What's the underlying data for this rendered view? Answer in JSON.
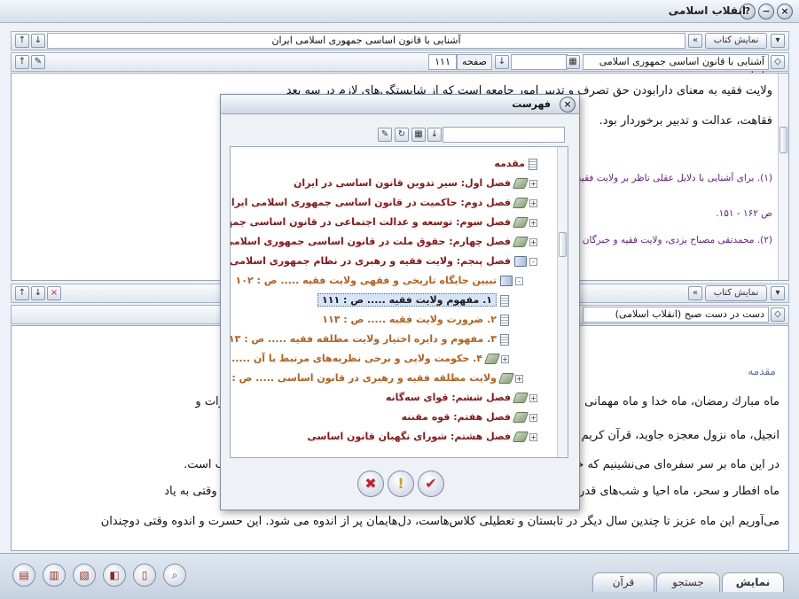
{
  "window": {
    "title": "انقلاب اسلامی"
  },
  "top_pane": {
    "view_book_label": "نمایش کتاب",
    "book_title": "آشنایی با قانون اساسی جمهوری اسلامی ایران",
    "book_select": "آشنایی با قانون اساسی جمهوری اسلامی ایران",
    "page_label": "صفحه",
    "page_value": "۱۱۱",
    "text_lines": [
      "ولایت فقیه به معنای دارابودن حق تصرف و تدبیر امور جامعه است که از شایستگی‌های لازم در سه بعد",
      "فقاهت، عدالت و تدبیر برخوردار بود."
    ],
    "footnotes": [
      "(۱). برای آشنایی با دلایل عقلی ناظر بر ولایت فقیه، رجوع شود به: جوادی آملی، ولایت فقیه؛ ولایت، فقاهت و عدالت،",
      "ص ۱۶۲ - ۱۵۱.",
      "(۲). محمدتقی مصباح یزدی، ولایت فقیه و خبرگان"
    ]
  },
  "bottom_pane": {
    "view_book_label": "نمایش کتاب",
    "book_select": "دست در دست صبح (انقلاب اسلامی)",
    "heading": "مقدمه",
    "text_lines": [
      "ماه مبارك رمضان، ماه خدا و ماه مهمانی خداست؛ ماه بهار قرآن و ماه دوستی و مهربانی دوست، ماه نزول زبور و تورات و",
      "انجیل، ماه نزول معجزه جاوید، قرآن کریم است؛ ماهی که نفس‌های روزه‌داران در آن تسبیح است.",
      "در این ماه بر سر سفره‌ای می‌نشینیم که خداوند گسترده است؛ خواب در آن عبادت، نفس‌ها تسبیح الهی و دعا مستجاب است.",
      "ماه افطار و سحر، ماه احیا و شب‌های قدر؛ ماهی که مسجد، محراب و جانماز سجده‌گاه و مسجد و خوابگاه است. ولی وقتی به یاد",
      "می‌آوریم این ماه عزیز تا چندین سال دیگر در تابستان و تعطیلی کلاس‌هاست، دل‌هایمان پر از اندوه می شود. این حسرت و اندوه وقتی دوچندان"
    ]
  },
  "dialog": {
    "title": "فهرست",
    "tree": [
      {
        "label": "مقدمه",
        "color": "brown",
        "icon": "page-icon",
        "level": 0,
        "toggle": ""
      },
      {
        "label": "فصل اول: سیر تدوین قانون اساسی در ایران",
        "color": "brown",
        "icon": "book-icon",
        "level": 0,
        "toggle": "+"
      },
      {
        "label": "فصل دوم: حاکمیت در قانون اساسی جمهوری اسلامی ایران",
        "color": "brown",
        "icon": "book-icon",
        "level": 0,
        "toggle": "+"
      },
      {
        "label": "فصل سوم: توسعه و عدالت اجتماعی در قانون اساسی جمهوری اسلامی ایران",
        "color": "brown",
        "icon": "book-icon",
        "level": 0,
        "toggle": "+"
      },
      {
        "label": "فصل چهارم: حقوق ملت در قانون اساسی جمهوری اسلامی ایران",
        "color": "brown",
        "icon": "book-icon",
        "level": 0,
        "toggle": "+"
      },
      {
        "label": "فصل پنجم: ولایت فقیه و رهبری در نظام جمهوری اسلامی ایران",
        "color": "brown",
        "icon": "open-book-icon",
        "level": 0,
        "toggle": "-"
      },
      {
        "label": "تبیین جایگاه تاریخی و فقهی ولایت فقیه ..... ص : ۱۰۲",
        "color": "orange",
        "icon": "open-book-icon",
        "level": 1,
        "toggle": "-"
      },
      {
        "label": "۱. مفهوم ولایت فقیه ..... ص : ۱۱۱",
        "color": "plain",
        "icon": "page-icon",
        "level": 2,
        "toggle": "",
        "selected": true
      },
      {
        "label": "۲. ضرورت ولایت فقیه ..... ص : ۱۱۳",
        "color": "orange",
        "icon": "page-icon",
        "level": 2,
        "toggle": ""
      },
      {
        "label": "۳. مفهوم و دایره اختیار ولایت مطلقه فقیه ..... ص : ۱۱۳",
        "color": "orange",
        "icon": "page-icon",
        "level": 2,
        "toggle": ""
      },
      {
        "label": "۴. حکومت ولایی و برخی نظریه‌های مرتبط با آن ..... ص : ۱۱۶",
        "color": "orange",
        "icon": "book-icon",
        "level": 2,
        "toggle": "+"
      },
      {
        "label": "ولایت مطلقه فقیه و رهبری در قانون اساسی ..... ص : ۱۲۰",
        "color": "orange",
        "icon": "book-icon",
        "level": 1,
        "toggle": "+"
      },
      {
        "label": "فصل ششم: قوای سه‌گانه",
        "color": "brown",
        "icon": "book-icon",
        "level": 0,
        "toggle": "+"
      },
      {
        "label": "فصل هفتم: قوه مقننه",
        "color": "brown",
        "icon": "book-icon",
        "level": 0,
        "toggle": "+"
      },
      {
        "label": "فصل هشتم: شورای نگهبان قانون اساسی",
        "color": "brown",
        "icon": "book-icon",
        "level": 0,
        "toggle": "+"
      }
    ]
  },
  "bottom_tabs": {
    "display": "نمایش",
    "search": "جستجو",
    "quran": "قرآن"
  },
  "colors": {
    "brown": "#8b1515",
    "orange": "#b5601b",
    "footnote": "#6b1b8a",
    "heading": "#5b6fb0"
  }
}
